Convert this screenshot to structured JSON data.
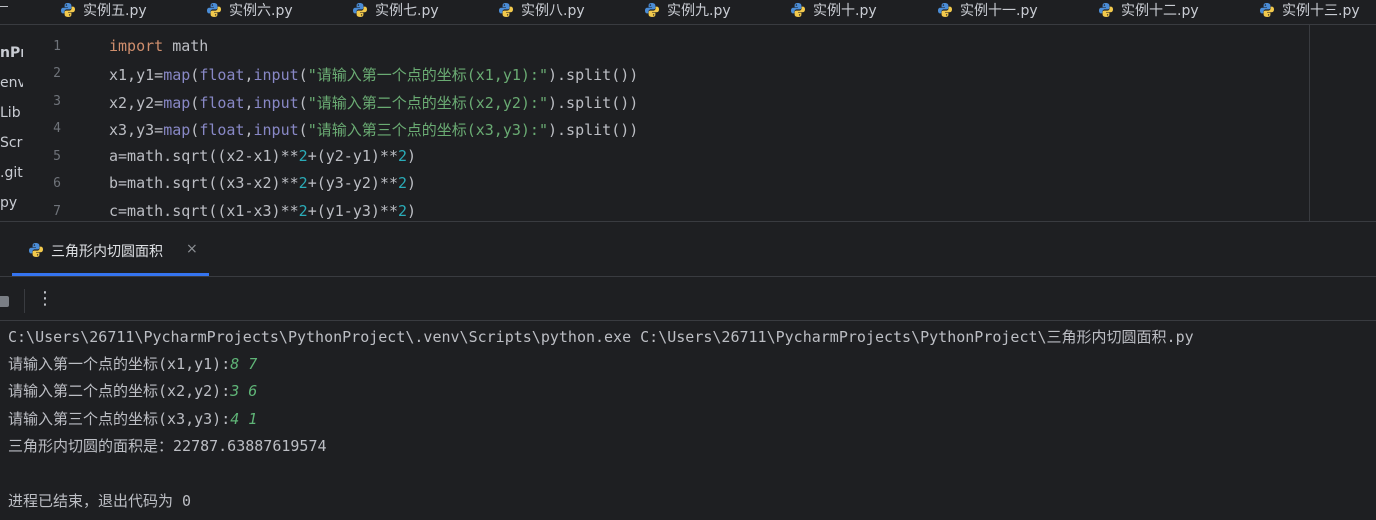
{
  "tabs": [
    {
      "label": "实例五.py"
    },
    {
      "label": "实例六.py"
    },
    {
      "label": "实例七.py"
    },
    {
      "label": "实例八.py"
    },
    {
      "label": "实例九.py"
    },
    {
      "label": "实例十.py"
    },
    {
      "label": "实例十一.py"
    },
    {
      "label": "实例十二.py"
    },
    {
      "label": "实例十三.py"
    }
  ],
  "project_tree": {
    "items": [
      {
        "label": "nPr"
      },
      {
        "label": "env"
      },
      {
        "label": "Lib"
      },
      {
        "label": "Scr"
      },
      {
        "label": ".giti"
      },
      {
        "label": "py"
      }
    ]
  },
  "editor": {
    "line_numbers": [
      "1",
      "2",
      "3",
      "4",
      "5",
      "6",
      "7"
    ],
    "lines": [
      "import math",
      "x1,y1=map(float,input(\"请输入第一个点的坐标(x1,y1):\").split())",
      "x2,y2=map(float,input(\"请输入第二个点的坐标(x2,y2):\").split())",
      "x3,y3=map(float,input(\"请输入第三个点的坐标(x3,y3):\").split())",
      "a=math.sqrt((x2-x1)**2+(y2-y1)**2)",
      "b=math.sqrt((x3-x2)**2+(y3-y2)**2)",
      "c=math.sqrt((x1-x3)**2+(y1-y3)**2)"
    ]
  },
  "run_window": {
    "tab_label": "三角形内切圆面积",
    "close_glyph": "×",
    "more_glyph": "⋮",
    "console": {
      "command": "C:\\Users\\26711\\PycharmProjects\\PythonProject\\.venv\\Scripts\\python.exe C:\\Users\\26711\\PycharmProjects\\PythonProject\\三角形内切圆面积.py",
      "prompts": [
        {
          "prompt": "请输入第一个点的坐标(x1,y1):",
          "input": "8 7"
        },
        {
          "prompt": "请输入第二个点的坐标(x2,y2):",
          "input": "3 6"
        },
        {
          "prompt": "请输入第三个点的坐标(x3,y3):",
          "input": "4 1"
        }
      ],
      "result": "三角形内切圆的面积是：22787.63887619574",
      "exit_message": "进程已结束，退出代码为 0"
    }
  },
  "colors": {
    "background": "#1e1f22",
    "keyword": "#cf8e6d",
    "builtin": "#8888c6",
    "string": "#6aab73",
    "number": "#2aacb8",
    "user_input": "#5fb477",
    "accent": "#3574f0"
  },
  "icons": {
    "tab_file": "python-file-icon",
    "run_tab": "python-run-icon",
    "stop": "stop-icon",
    "more": "more-vertical-icon"
  }
}
